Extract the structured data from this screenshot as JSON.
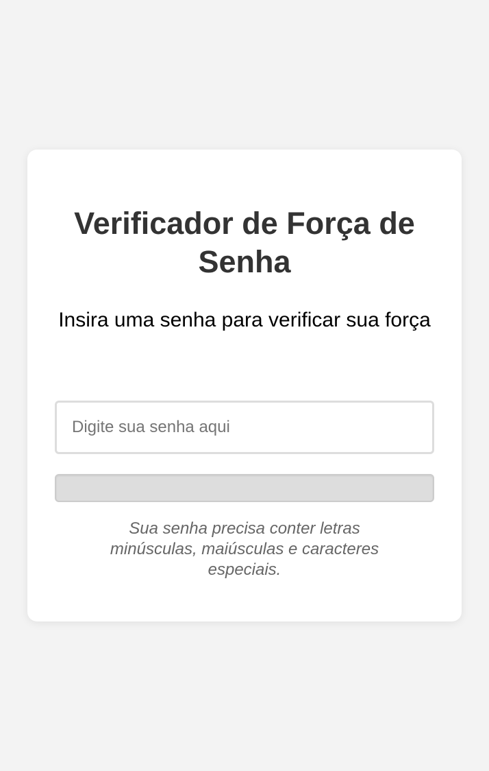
{
  "page": {
    "title": "Verificador de Força de Senha",
    "subtitle": "Insira uma senha para verificar sua força"
  },
  "password_input": {
    "value": "",
    "placeholder": "Digite sua senha aqui"
  },
  "strength_meter": {
    "level_percent": 0
  },
  "hint": "Sua senha precisa conter letras minúsculas, maiúsculas e caracteres especiais.",
  "colors": {
    "background": "#f3f3f3",
    "card": "#ffffff",
    "title_text": "#333333",
    "meter_track": "#dddddd",
    "hint_text": "#666666"
  }
}
